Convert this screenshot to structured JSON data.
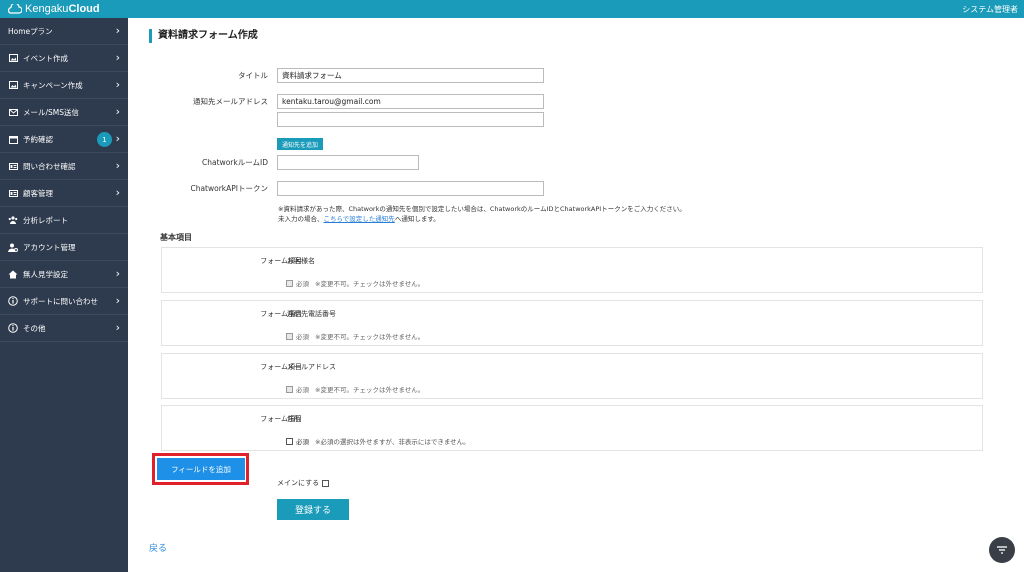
{
  "app": {
    "logo_prefix": "Kengaku",
    "logo_bold": "Cloud",
    "admin_label": "システム管理者"
  },
  "sidebar": {
    "items": [
      {
        "label": "Homeプラン",
        "icon": "none",
        "chevron": true
      },
      {
        "label": "イベント作成",
        "icon": "image-icon",
        "chevron": true
      },
      {
        "label": "キャンペーン作成",
        "icon": "image-icon",
        "chevron": true
      },
      {
        "label": "メール/SMS送信",
        "icon": "mail-icon",
        "chevron": true
      },
      {
        "label": "予約確認",
        "icon": "calendar-icon",
        "chevron": true,
        "badge": "1"
      },
      {
        "label": "問い合わせ確認",
        "icon": "id-card-icon",
        "chevron": true
      },
      {
        "label": "顧客管理",
        "icon": "id-card-icon",
        "chevron": true
      },
      {
        "label": "分析レポート",
        "icon": "users-icon",
        "chevron": false
      },
      {
        "label": "アカウント管理",
        "icon": "user-gear-icon",
        "chevron": false
      },
      {
        "label": "無人見学設定",
        "icon": "home-icon",
        "chevron": true
      },
      {
        "label": "サポートに問い合わせ",
        "icon": "info-icon",
        "chevron": true
      },
      {
        "label": "その他",
        "icon": "info-icon",
        "chevron": true
      }
    ]
  },
  "page": {
    "title": "資料請求フォーム作成"
  },
  "form": {
    "title_label": "タイトル",
    "title_value": "資料請求フォーム",
    "email_label": "通知先メールアドレス",
    "email_value_1": "kentaku.tarou@gmail.com",
    "email_value_2": "",
    "add_recipient_label": "通知先を追加",
    "chatwork_room_label": "ChatworkルームID",
    "chatwork_room_value": "",
    "chatwork_token_label": "ChatworkAPIトークン",
    "chatwork_token_value": "",
    "note_line_1": "※資料請求があった際、Chatworkの通知先を個別で設定したい場合は、ChatworkのルームIDとChatworkAPIトークンをご入力ください。",
    "note_line_2_prefix": "未入力の場合、",
    "note_line_2_link": "こちらで設定した通知先",
    "note_line_2_suffix": "へ通知します。"
  },
  "fields_section": {
    "title": "基本項目",
    "items": [
      {
        "label": "フォーム項目",
        "name": "お客様名",
        "required_label": "必須",
        "note": "※変更不可。チェックは外せません。",
        "editable": false
      },
      {
        "label": "フォーム項目",
        "name": "連絡先電話番号",
        "required_label": "必須",
        "note": "※変更不可。チェックは外せません。",
        "editable": false
      },
      {
        "label": "フォーム項目",
        "name": "メールアドレス",
        "required_label": "必須",
        "note": "※変更不可。チェックは外せません。",
        "editable": false
      },
      {
        "label": "フォーム項目",
        "name": "住所",
        "required_label": "必須",
        "note": "※必須の選択は外せますが、非表示にはできません。",
        "editable": true
      }
    ]
  },
  "actions": {
    "add_field_label": "フィールドを追加",
    "make_main_label": "メインにする",
    "submit_label": "登録する",
    "back_label": "戻る"
  },
  "colors": {
    "header": "#1a9bba",
    "sidebar": "#2e3a4d",
    "primary_button": "#1e90e8",
    "highlight": "#e0202a"
  }
}
